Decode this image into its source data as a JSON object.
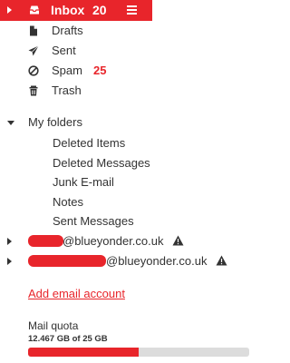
{
  "inbox": {
    "label": "Inbox",
    "count": "20"
  },
  "folders": [
    {
      "label": "Drafts",
      "icon": "file-icon"
    },
    {
      "label": "Sent",
      "icon": "paper-plane-icon"
    },
    {
      "label": "Spam",
      "icon": "ban-icon",
      "count": "25"
    },
    {
      "label": "Trash",
      "icon": "trash-icon"
    }
  ],
  "my_folders": {
    "label": "My folders",
    "items": [
      "Deleted Items",
      "Deleted Messages",
      "Junk E-mail",
      "Notes",
      "Sent Messages"
    ]
  },
  "accounts": [
    {
      "domain": "@blueyonder.co.uk",
      "warning_icon": "warning-icon"
    },
    {
      "domain": "@blueyonder.co.uk",
      "warning_icon": "warning-icon"
    }
  ],
  "add_account_label": "Add email account",
  "quota": {
    "title": "Mail quota",
    "value": "12.467 GB of 25 GB",
    "used_fraction": 0.4987
  },
  "colors": {
    "accent": "#e8252b",
    "track": "#dcdcdc",
    "text": "#333333"
  }
}
